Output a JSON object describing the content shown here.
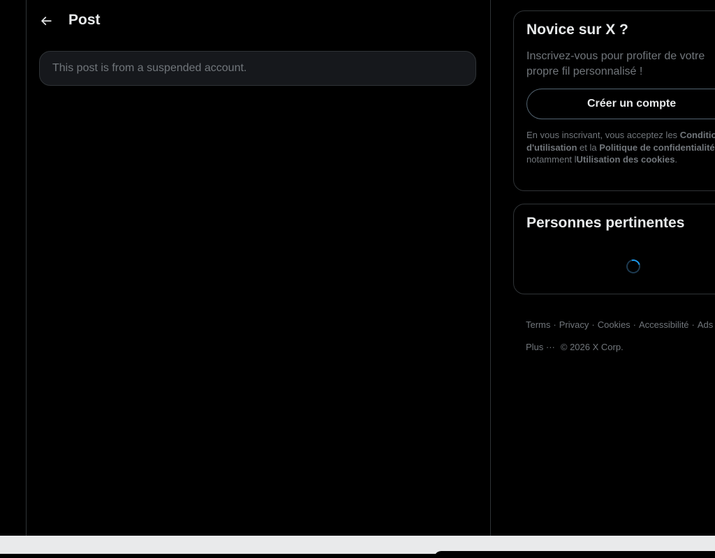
{
  "header": {
    "title": "Post",
    "back_icon": "arrow-left-icon"
  },
  "main": {
    "suspended_message": "This post is from a suspended account."
  },
  "signup_card": {
    "title": "Novice sur X ?",
    "description": "Inscrivez-vous pour profiter de votre propre fil personnalisé !",
    "create_button": "Créer un compte",
    "legal": {
      "prefix": "En vous inscrivant, vous acceptez les",
      "terms_link": "Conditions d'utilisation",
      "and": "et la",
      "privacy_link": "Politique de confidentialité",
      "including": ", notamment l",
      "cookies_link": "Utilisation des cookies",
      "suffix": "."
    }
  },
  "people_card": {
    "title": "Personnes pertinentes"
  },
  "footer": {
    "links": [
      "Terms",
      "Privacy",
      "Cookies",
      "Accessibilité",
      "Ads Info"
    ],
    "more": "Plus ···",
    "copyright": "© 2026 X Corp."
  },
  "colors": {
    "background": "#000000",
    "border": "#2f3336",
    "text_primary": "#e7e9ea",
    "text_secondary": "#71767b",
    "accent": "#1d9bf0"
  }
}
